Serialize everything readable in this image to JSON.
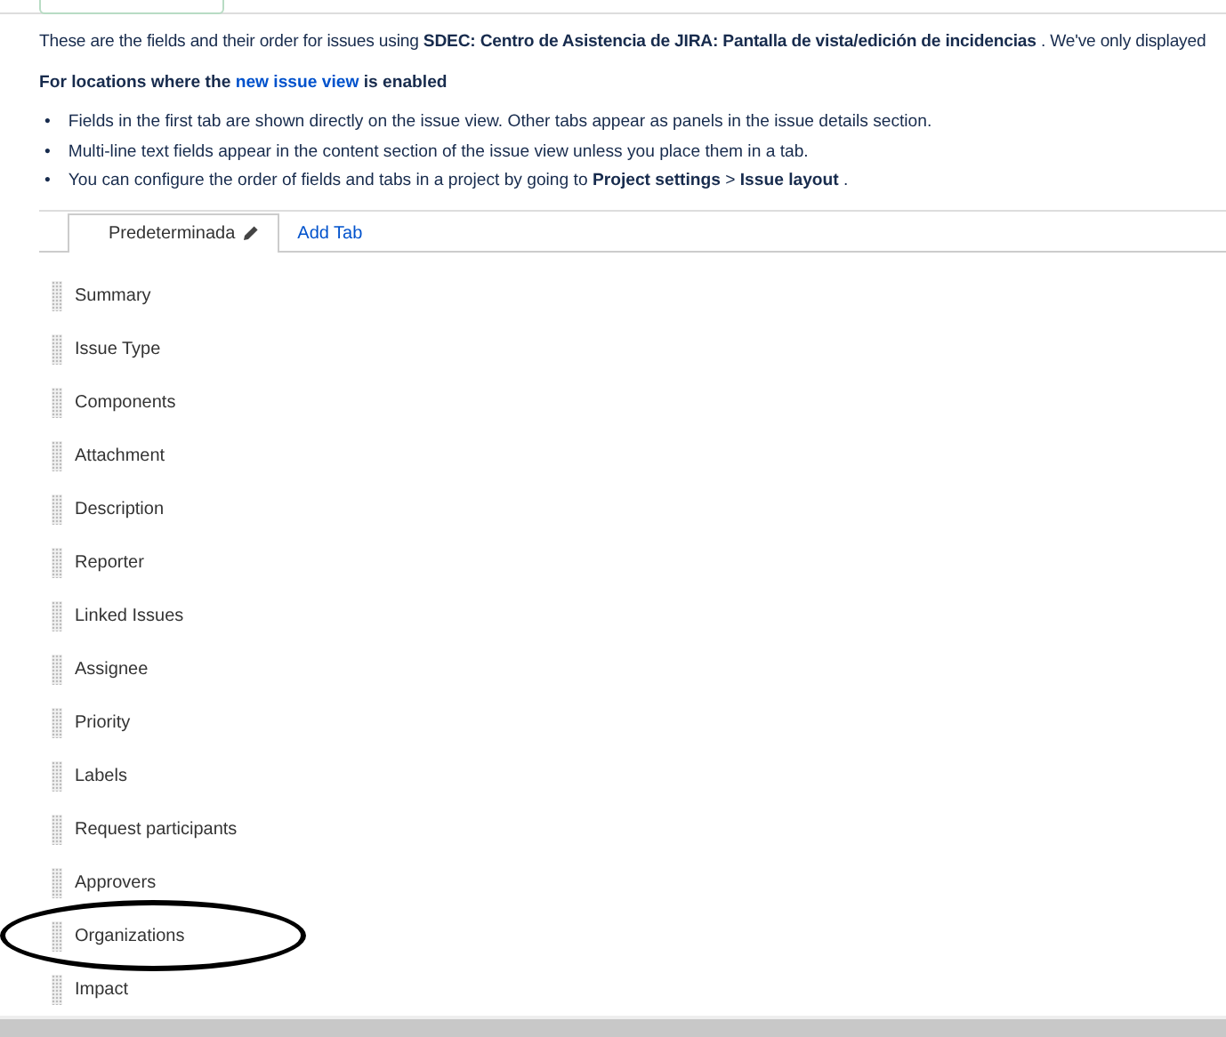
{
  "intro": "These are the fields and their order for issues using **SDEC: Centro de Asistencia de JIRA: Pantalla de vista/edición de incidencias** . We've only displayed",
  "heading": {
    "before": "For locations where the",
    "link": "new issue view",
    "after": "is enabled"
  },
  "bullets": [
    {
      "marker": "•",
      "text": "Fields in the first tab are shown directly on the issue view. Other tabs appear as panels in the issue details section."
    },
    {
      "marker": "•",
      "text": "Multi-line text fields appear in the content section of the issue view unless you place them in a tab."
    },
    {
      "marker": "•",
      "text": "You can configure the order of fields and tabs in a project by going to **Project settings** > **Issue layout** ."
    }
  ],
  "tabs": [
    {
      "label": "Predeterminada",
      "selected": true
    }
  ],
  "add_tab": "Add Tab",
  "fields": [
    {
      "name": "Summary",
      "circled": false
    },
    {
      "name": "Issue Type",
      "circled": false
    },
    {
      "name": "Components",
      "circled": false
    },
    {
      "name": "Attachment",
      "circled": false
    },
    {
      "name": "Description",
      "circled": false
    },
    {
      "name": "Reporter",
      "circled": false
    },
    {
      "name": "Linked Issues",
      "circled": false
    },
    {
      "name": "Assignee",
      "circled": false
    },
    {
      "name": "Priority",
      "circled": false
    },
    {
      "name": "Labels",
      "circled": false
    },
    {
      "name": "Request participants",
      "circled": false
    },
    {
      "name": "Approvers",
      "circled": false
    },
    {
      "name": "Organizations",
      "circled": true
    },
    {
      "name": "Impact",
      "circled": false
    }
  ]
}
